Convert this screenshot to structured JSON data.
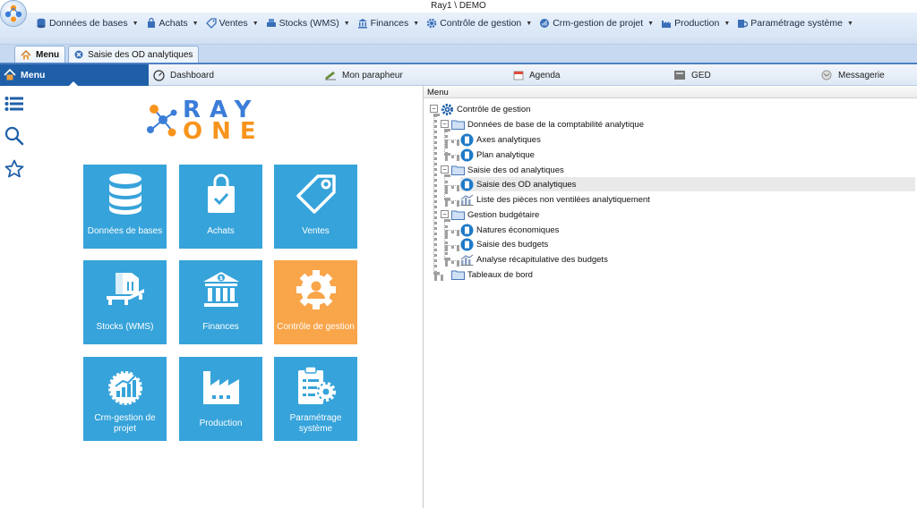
{
  "window": {
    "title": "Ray1 \\ DEMO"
  },
  "menubar": {
    "items": [
      {
        "label": "Données de bases",
        "icon": "database-icon"
      },
      {
        "label": "Achats",
        "icon": "bag-icon"
      },
      {
        "label": "Ventes",
        "icon": "tag-icon"
      },
      {
        "label": "Stocks (WMS)",
        "icon": "stock-icon"
      },
      {
        "label": "Finances",
        "icon": "bank-icon"
      },
      {
        "label": "Contrôle de gestion",
        "icon": "gear-icon"
      },
      {
        "label": "Crm-gestion de projet",
        "icon": "crm-icon"
      },
      {
        "label": "Production",
        "icon": "factory-icon"
      },
      {
        "label": "Paramétrage système",
        "icon": "settings-icon"
      }
    ]
  },
  "doctabs": [
    {
      "label": "Menu"
    },
    {
      "label": "Saisie des OD analytiques"
    }
  ],
  "navbar": {
    "menu_label": "Menu",
    "items": [
      {
        "label": "Dashboard"
      },
      {
        "label": "Mon parapheur"
      },
      {
        "label": "Agenda"
      },
      {
        "label": "GED"
      },
      {
        "label": "Messagerie"
      }
    ]
  },
  "logo": {
    "top": "RAY",
    "bottom": "ONE"
  },
  "tiles": [
    {
      "label": "Données de bases"
    },
    {
      "label": "Achats"
    },
    {
      "label": "Ventes"
    },
    {
      "label": "Stocks (WMS)"
    },
    {
      "label": "Finances"
    },
    {
      "label": "Contrôle de gestion"
    },
    {
      "label": "Crm-gestion de projet"
    },
    {
      "label": "Production"
    },
    {
      "label": "Paramétrage système"
    }
  ],
  "menu_panel": {
    "title": "Menu",
    "tree": {
      "root": "Contrôle de gestion",
      "groups": [
        {
          "label": "Données de base de la comptabilité analytique",
          "children": [
            "Axes analytiques",
            "Plan analytique"
          ]
        },
        {
          "label": "Saisie des od analytiques",
          "children": [
            "Saisie des OD analytiques",
            "Liste des pièces non ventilées analytiquement"
          ]
        },
        {
          "label": "Gestion budgétaire",
          "children": [
            "Natures économiques",
            "Saisie des budgets",
            "Analyse récapitulative des budgets"
          ]
        },
        {
          "label": "Tableaux de bord",
          "children": []
        }
      ],
      "selected": "Saisie des OD analytiques"
    }
  },
  "colors": {
    "tile_blue": "#36a3da",
    "tile_orange": "#f9a54a",
    "nav_active": "#1f5fa8",
    "logo_blue": "#3b7dd8",
    "logo_orange": "#f7941d"
  }
}
